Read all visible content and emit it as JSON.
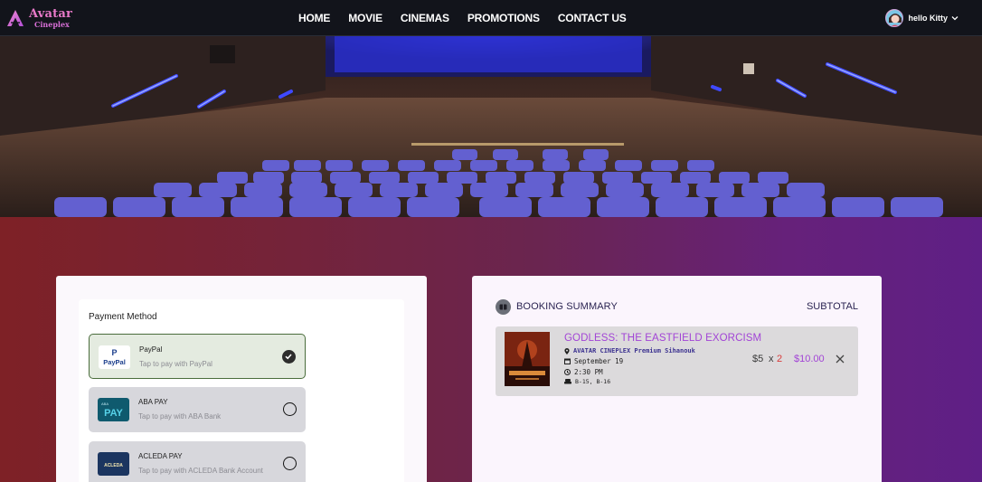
{
  "brand": {
    "name": "Avatar",
    "sub": "Cineplex",
    "accent": "#e879c9"
  },
  "nav": {
    "items": [
      "HOME",
      "MOVIE",
      "CINEMAS",
      "PROMOTIONS",
      "CONTACT US"
    ]
  },
  "user": {
    "greeting": "hello Kitty"
  },
  "payment": {
    "title": "Payment Method",
    "methods": [
      {
        "name": "PayPal",
        "desc": "Tap to pay with PayPal",
        "logo_text": "PayPal",
        "selected": true
      },
      {
        "name": "ABA PAY",
        "desc": "Tap to pay with ABA Bank",
        "logo_text": "PAY",
        "logo_small": "ABA",
        "selected": false
      },
      {
        "name": "ACLEDA PAY",
        "desc": "Tap to pay with ACLEDA Bank Account",
        "logo_text": "ACLEDA",
        "selected": false
      }
    ]
  },
  "summary": {
    "title": "BOOKING SUMMARY",
    "subtotal_label": "SUBTOTAL",
    "item": {
      "movie": "GODLESS: THE EASTFIELD EXORCISM",
      "cinema": "AVATAR CINEPLEX Premium Sihanouk",
      "date": "September 19",
      "time": "2:30 PM",
      "seats": "B-15, B-16",
      "price": "$5",
      "x": "x",
      "quantity": "2",
      "total": "$10.00"
    }
  },
  "colors": {
    "selected_border": "#4a6d3c",
    "title_purple": "#a244d6",
    "qty_red": "#d93a3a"
  }
}
